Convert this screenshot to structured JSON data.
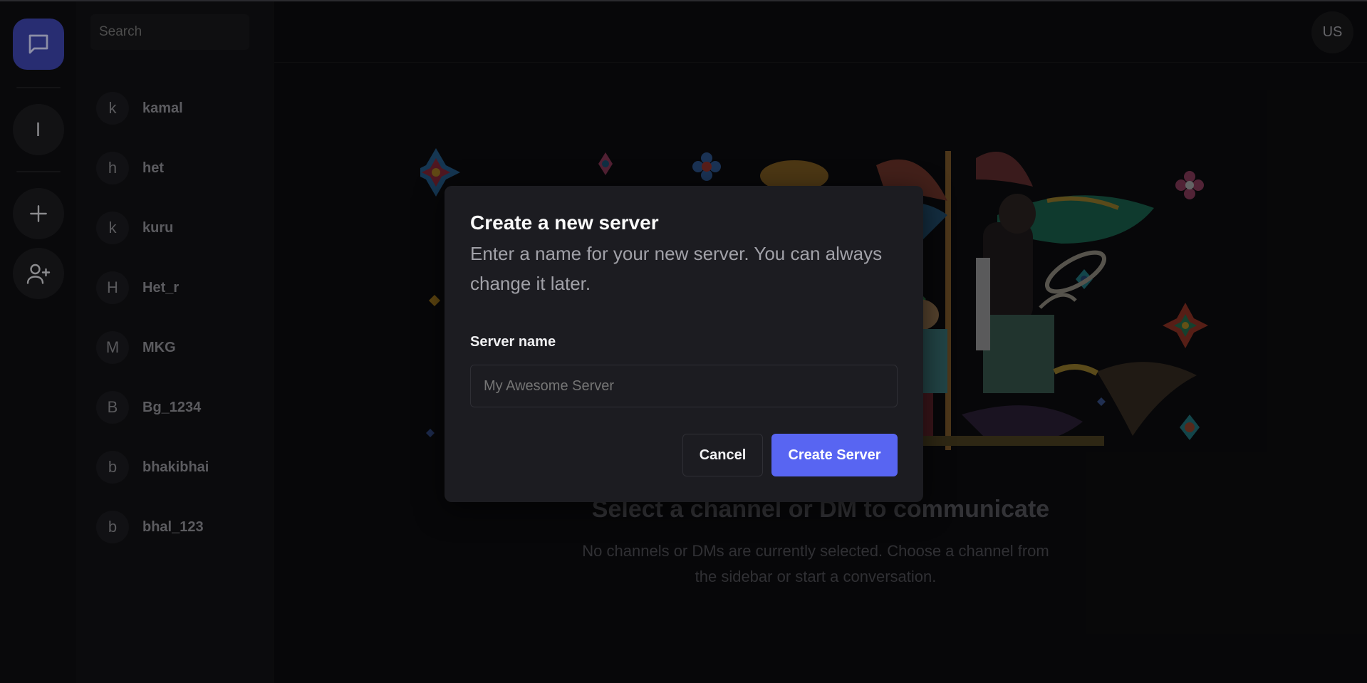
{
  "rail": {
    "server_initial": "I"
  },
  "sidebar": {
    "search_placeholder": "Search",
    "dms": [
      {
        "initial": "k",
        "name": "kamal"
      },
      {
        "initial": "h",
        "name": "het"
      },
      {
        "initial": "k",
        "name": "kuru"
      },
      {
        "initial": "H",
        "name": "Het_r"
      },
      {
        "initial": "M",
        "name": "MKG"
      },
      {
        "initial": "B",
        "name": "Bg_1234"
      },
      {
        "initial": "b",
        "name": "bhakibhai"
      },
      {
        "initial": "b",
        "name": "bhal_123"
      }
    ]
  },
  "header": {
    "user_initials": "US"
  },
  "empty_state": {
    "title": "Select a channel or DM to communicate",
    "subtitle": "No channels or DMs are currently selected. Choose a channel from the sidebar or start a conversation."
  },
  "modal": {
    "title": "Create a new server",
    "description": "Enter a name for your new server. You can always change it later.",
    "field_label": "Server name",
    "field_placeholder": "My Awesome Server",
    "cancel_label": "Cancel",
    "create_label": "Create Server"
  },
  "colors": {
    "accent": "#5865f2",
    "active_rail": "#3e45b0",
    "modal_bg": "#1c1c21"
  },
  "icons": {
    "rail_top": "message-square-icon",
    "add_server": "plus-icon",
    "add_friend": "user-plus-icon"
  }
}
